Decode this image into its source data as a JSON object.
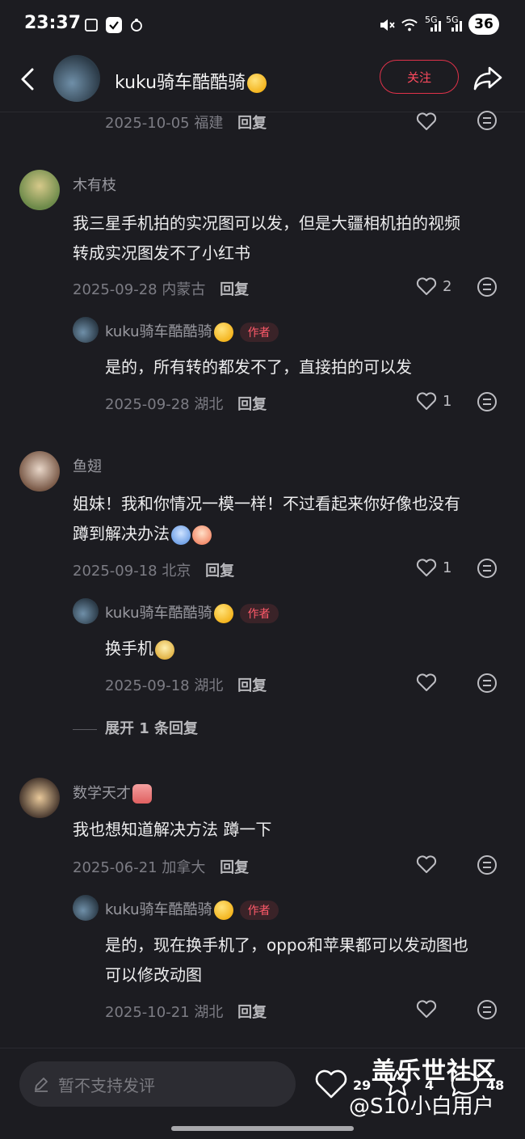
{
  "status_bar": {
    "time": "23:37",
    "battery": "36",
    "net1": "5G",
    "net2": "5G"
  },
  "header": {
    "author_name": "kuku骑车酷酷骑",
    "follow_label": "关注"
  },
  "top_partial": {
    "date": "2025-10-05",
    "location": "福建",
    "reply_label": "回复"
  },
  "comments": [
    {
      "name": "木有枝",
      "text_line1": "我三星手机拍的实况图可以发，但是大疆相机拍的视频",
      "text_line2": "转成实况图发不了小红书",
      "date": "2025-09-28",
      "location": "内蒙古",
      "reply_label": "回复",
      "likes": "2",
      "reply": {
        "name": "kuku骑车酷酷骑",
        "tag": "作者",
        "text": "是的，所有转的都发不了，直接拍的可以发",
        "date": "2025-09-28",
        "location": "湖北",
        "reply_label": "回复",
        "likes": "1"
      }
    },
    {
      "name": "鱼翅",
      "text_line1": "姐妹！我和你情况一模一样！不过看起来你好像也没有",
      "text_line2": "蹲到解决办法",
      "date": "2025-09-18",
      "location": "北京",
      "reply_label": "回复",
      "likes": "1",
      "reply": {
        "name": "kuku骑车酷酷骑",
        "tag": "作者",
        "text": "换手机",
        "date": "2025-09-18",
        "location": "湖北",
        "reply_label": "回复",
        "likes": ""
      },
      "expand_label": "展开 1 条回复"
    },
    {
      "name": "数学天才",
      "text_line1": "我也想知道解决方法 蹲一下",
      "date": "2025-06-21",
      "location": "加拿大",
      "reply_label": "回复",
      "likes": "",
      "reply": {
        "name": "kuku骑车酷酷骑",
        "tag": "作者",
        "text_line1": "是的，现在换手机了，oppo和苹果都可以发动图也",
        "text_line2": "可以修改动图",
        "date": "2025-10-21",
        "location": "湖北",
        "reply_label": "回复",
        "likes": ""
      }
    }
  ],
  "bottom_bar": {
    "input_placeholder": "暂不支持发评",
    "likes_count": "29",
    "fav_count": "4",
    "comment_count": "48"
  },
  "watermark": {
    "line1": "盖乐世社区",
    "line2": "@S10小白用户"
  },
  "colors": {
    "background": "#1c1c21",
    "accent": "#ff4a5e",
    "muted": "#7c7c84"
  }
}
